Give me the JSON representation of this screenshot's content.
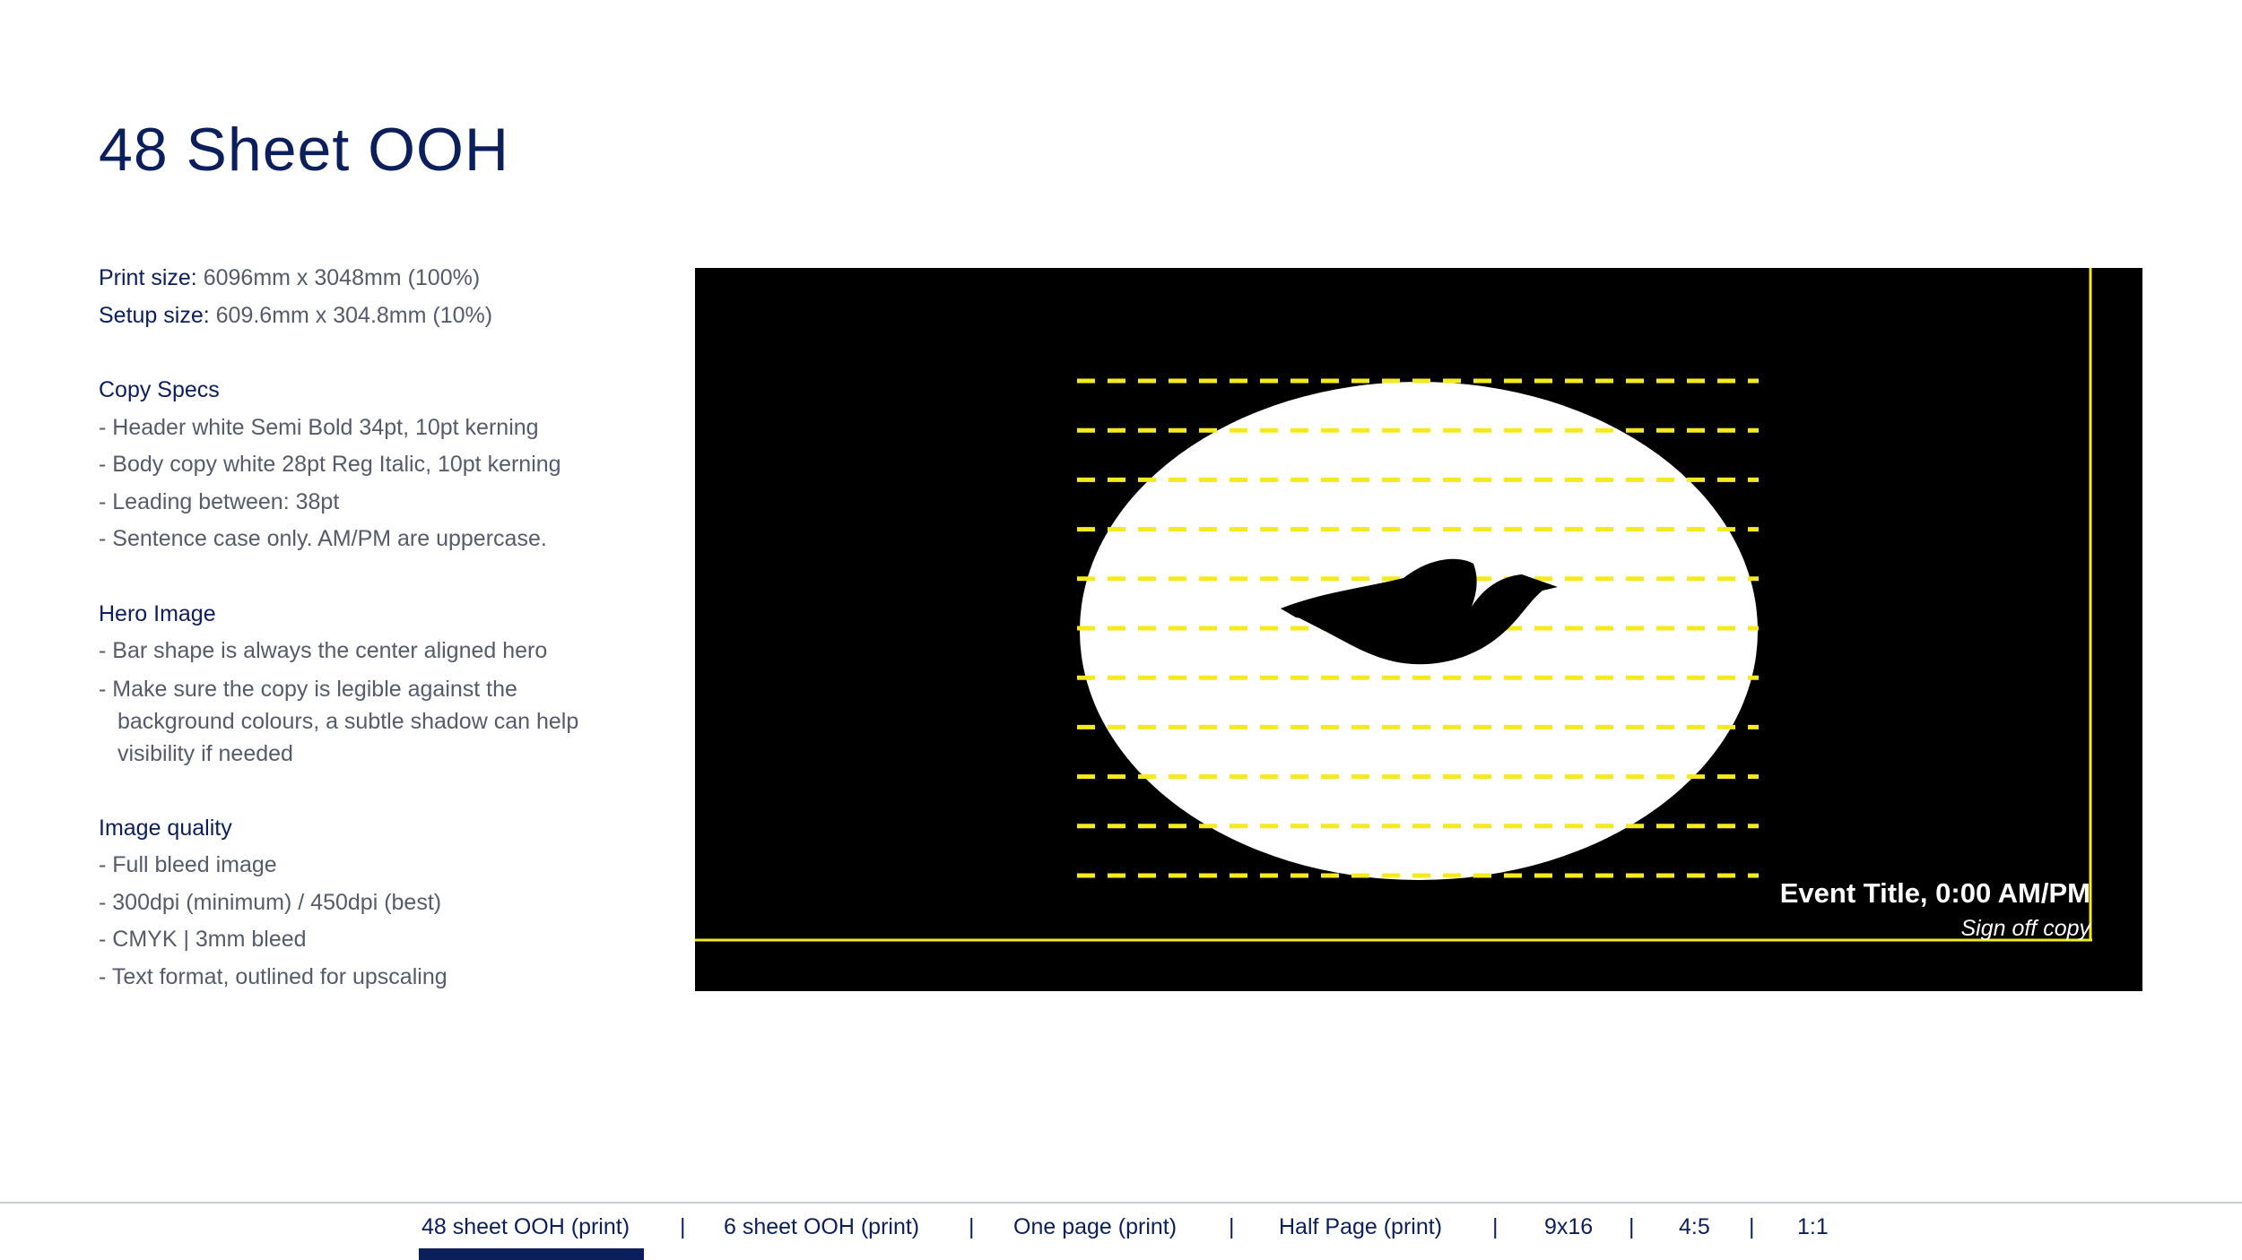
{
  "page": {
    "title": "48 Sheet OOH"
  },
  "sizes": {
    "print_label": "Print size:",
    "print_value": " 6096mm x 3048mm (100%)",
    "setup_label": "Setup size:",
    "setup_value": " 609.6mm x 304.8mm (10%)"
  },
  "copy_specs": {
    "heading": "Copy Specs",
    "items": [
      "- Header white Semi Bold 34pt, 10pt kerning",
      "- Body copy white 28pt Reg Italic, 10pt kerning",
      "- Leading between: 38pt",
      "- Sentence case only. AM/PM are uppercase."
    ]
  },
  "hero_image": {
    "heading": "Hero Image",
    "items": [
      "- Bar shape is always the center aligned hero",
      "- Make sure the copy is legible against the background colours, a subtle shadow can help visibility if needed"
    ]
  },
  "image_quality": {
    "heading": "Image quality",
    "items": [
      "- Full bleed image",
      "- 300dpi (minimum) / 450dpi (best)",
      "- CMYK | 3mm bleed",
      "- Text format, outlined for upscaling"
    ]
  },
  "artboard": {
    "event_title": "Event Title, 0:00 AM/PM",
    "sign_off": "Sign off copy",
    "colors": {
      "background": "#000000",
      "guide": "#f5ea1d",
      "shape": "#ffffff",
      "logo": "#000000"
    },
    "icons": [
      "dove-logo-icon"
    ]
  },
  "nav": {
    "tabs": [
      "48 sheet OOH (print)",
      "6 sheet OOH (print)",
      "One page (print)",
      "Half Page (print)",
      "9x16",
      "4:5",
      "1:1"
    ],
    "separator": "|",
    "active_index": 0
  },
  "colors": {
    "brand_navy": "#0b1f5c",
    "body_grey": "#555b6a"
  }
}
